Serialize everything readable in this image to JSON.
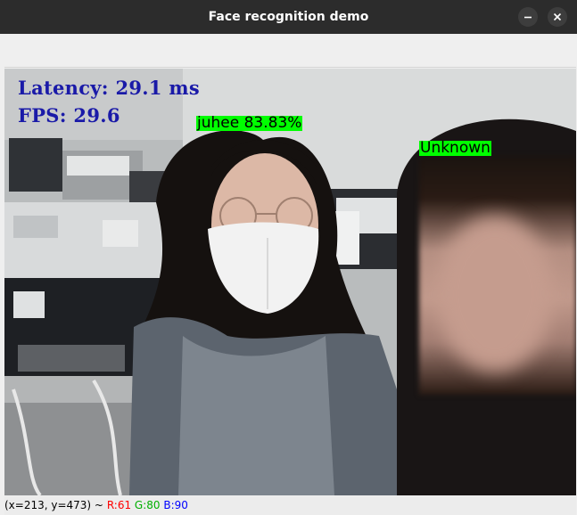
{
  "window": {
    "title": "Face recognition demo",
    "minimize_icon": "minimize-icon",
    "close_icon": "close-icon"
  },
  "overlay": {
    "latency": "Latency: 29.1 ms",
    "fps": "FPS: 29.6",
    "text_color": "#1a1aa8"
  },
  "faces": [
    {
      "label": "juhee 83.83%",
      "color": "#00ff00"
    },
    {
      "label": "Unknown",
      "color": "#00ff00"
    }
  ],
  "status": {
    "coords": "(x=213, y=473) ~",
    "r": "R:61",
    "g": "G:80",
    "b": "B:90",
    "r_color": "#ff0000",
    "g_color": "#00d000",
    "b_color": "#0000ff"
  }
}
